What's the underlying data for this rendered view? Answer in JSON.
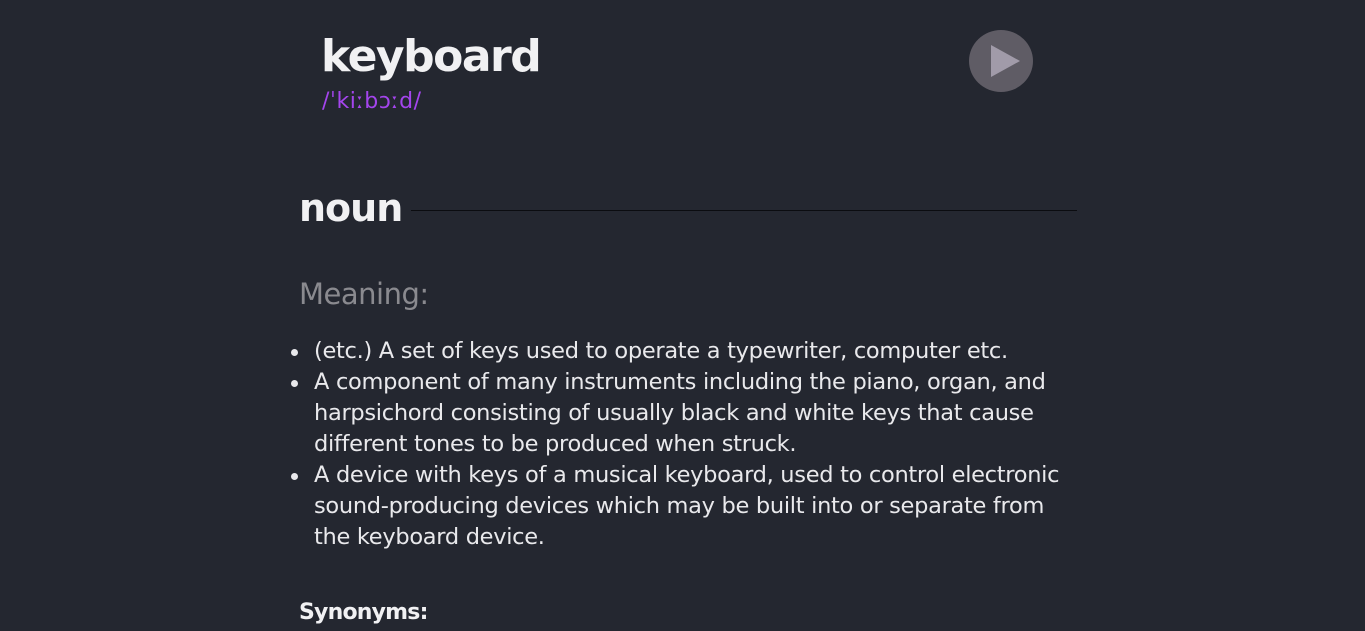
{
  "entry": {
    "word": "keyboard",
    "phonetic": "/ˈkiːbɔːd/",
    "play_icon": "play-icon"
  },
  "meaning_section": {
    "part_of_speech": "noun",
    "heading": "Meaning:",
    "definitions": [
      "(etc.) A set of keys used to operate a typewriter, computer etc.",
      "A component of many instruments including the piano, organ, and harpsichord consisting of usually black and white keys that cause different tones to be produced when struck.",
      "A device with keys of a musical keyboard, used to control electronic sound-producing devices which may be built into or separate from the keyboard device."
    ],
    "synonyms_label": "Synonyms:"
  },
  "colors": {
    "background": "#242730",
    "accent": "#a445ed",
    "play_button": "#5f5c65",
    "play_glyph": "#a19ba9"
  }
}
